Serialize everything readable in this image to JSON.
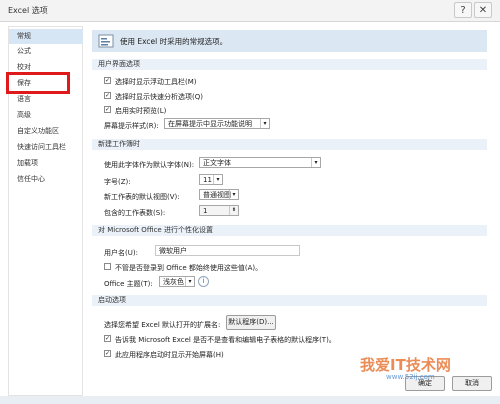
{
  "window": {
    "title": "Excel 选项",
    "help_glyph": "?",
    "close_glyph": "✕"
  },
  "sidebar": {
    "items": [
      {
        "label": "常规",
        "active": true
      },
      {
        "label": "公式"
      },
      {
        "label": "校对"
      },
      {
        "label": "保存"
      },
      {
        "label": "语言"
      },
      {
        "label": "高级"
      },
      {
        "label": "自定义功能区"
      },
      {
        "label": "快速访问工具栏"
      },
      {
        "label": "加载项"
      },
      {
        "label": "信任中心"
      }
    ]
  },
  "header": {
    "text": "使用 Excel 时采用的常规选项。",
    "icon": "settings-icon"
  },
  "ui_section": {
    "title": "用户界面选项",
    "show_mini_toolbar": "选择时显示浮动工具栏(M)",
    "show_quick_analysis": "选择时显示快速分析选项(Q)",
    "live_preview": "启用实时预览(L)",
    "screentip_label": "屏幕提示样式(R):",
    "screentip_value": "在屏幕提示中显示功能说明"
  },
  "workbook_section": {
    "title": "新建工作簿时",
    "font_label": "使用此字体作为默认字体(N):",
    "font_value": "正文字体",
    "size_label": "字号(Z):",
    "size_value": "11",
    "view_label": "新工作表的默认视图(V):",
    "view_value": "普通视图",
    "sheets_label": "包含的工作表数(S):",
    "sheets_value": "1"
  },
  "personalize_section": {
    "title": "对 Microsoft Office 进行个性化设置",
    "username_label": "用户名(U):",
    "username_value": "微软用户",
    "always_use_label": "不管是否登录到 Office 都始终使用这些值(A)。",
    "theme_label": "Office 主题(T):",
    "theme_value": "浅灰色"
  },
  "startup_section": {
    "title": "启动选项",
    "ext_label": "选择您希望 Excel 默认打开的扩展名:",
    "default_programs": "默认程序(D)...",
    "notify_label": "告诉我 Microsoft Excel 是否不是查看和编辑电子表格的默认程序(T)。",
    "show_start_label": "此应用程序启动时显示开始屏幕(H)"
  },
  "footer": {
    "ok": "确定",
    "cancel": "取消"
  },
  "watermark": {
    "text": "我爱IT技术网",
    "url": "www.52ij.com"
  },
  "colors": {
    "highlight": "#e01a1a",
    "active_nav": "#d7e6f5",
    "section_bg": "#eaf1f8"
  }
}
